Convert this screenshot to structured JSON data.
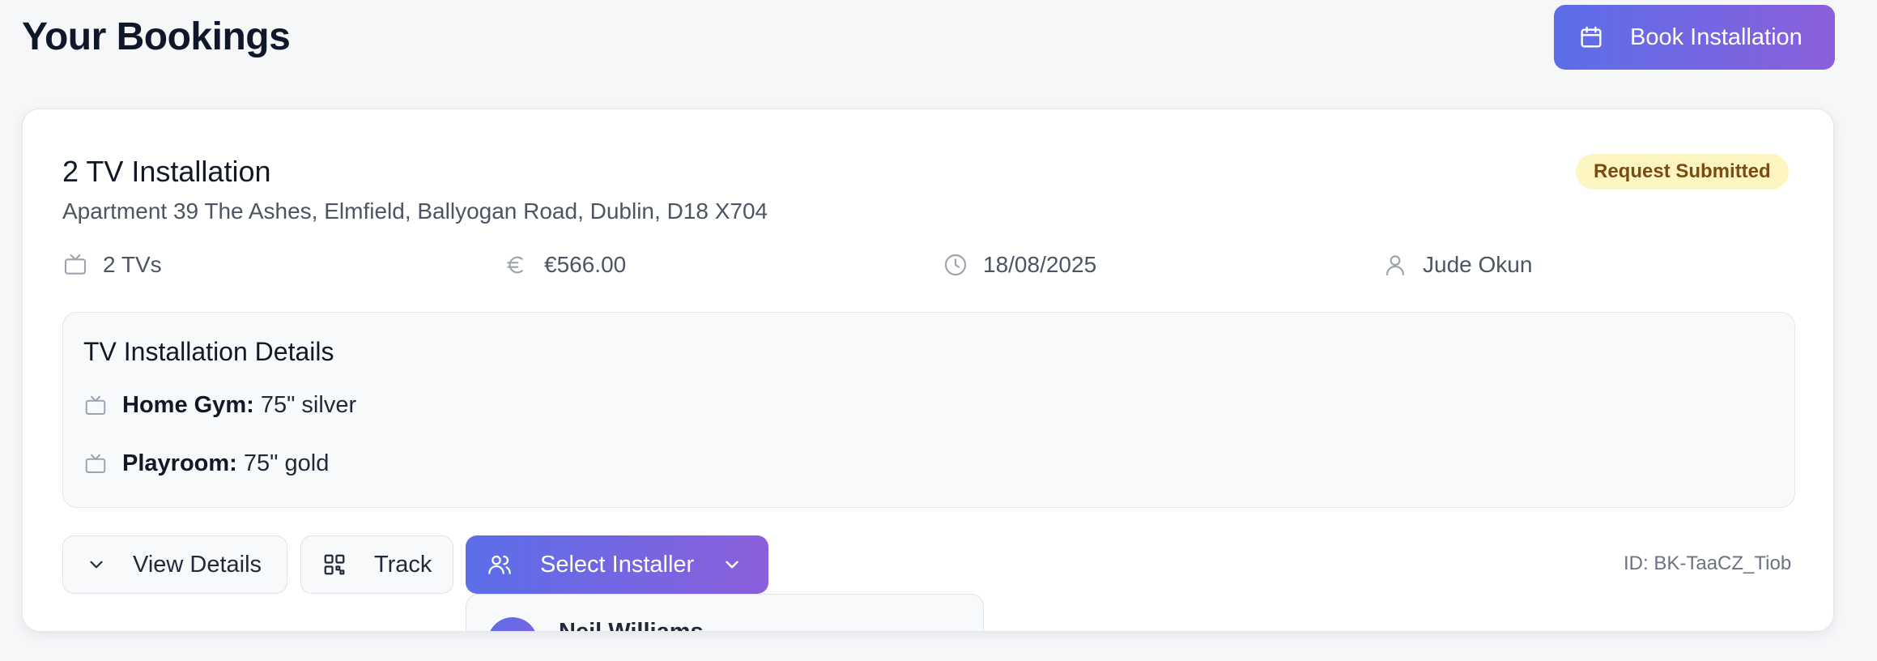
{
  "header": {
    "title": "Your Bookings",
    "book_button_label": "Book Installation"
  },
  "booking": {
    "title": "2 TV Installation",
    "address": "Apartment 39 The Ashes, Elmfield, Ballyogan Road, Dublin, D18 X704",
    "status": "Request Submitted",
    "meta": {
      "tvs": "2 TVs",
      "price": "€566.00",
      "date": "18/08/2025",
      "customer": "Jude Okun"
    },
    "details": {
      "title": "TV Installation Details",
      "items": [
        {
          "room": "Home Gym:",
          "spec": "75\" silver"
        },
        {
          "room": "Playroom:",
          "spec": "75\" gold"
        }
      ]
    },
    "actions": {
      "view_details": "View Details",
      "track": "Track",
      "select_installer": "Select Installer"
    },
    "id_label": "ID: BK-TaaCZ_Tiob"
  },
  "installer_dropdown": {
    "options": [
      {
        "name": "Neil Williams"
      }
    ]
  },
  "colors": {
    "accent_start": "#5b6ee8",
    "accent_end": "#8b5fdc",
    "status_bg": "#fdf6c3",
    "status_text": "#7a4b12"
  }
}
